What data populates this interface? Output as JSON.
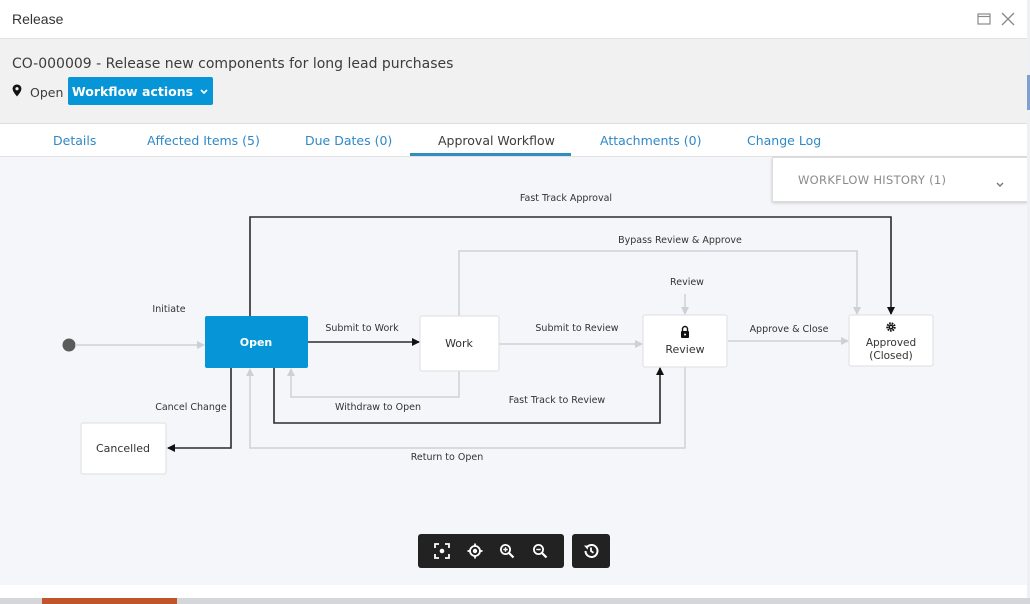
{
  "window": {
    "title": "Release",
    "maximize_icon": "window-maximize-icon",
    "close_icon": "close-icon"
  },
  "header": {
    "item_title": "CO-000009 - Release new components for long lead purchases",
    "state_icon": "map-pin-icon",
    "state": "Open",
    "workflow_actions_label": "Workflow actions"
  },
  "tabs": [
    {
      "label": "Details",
      "active": false
    },
    {
      "label": "Affected Items (5)",
      "active": false
    },
    {
      "label": "Due Dates (0)",
      "active": false
    },
    {
      "label": "Approval Workflow",
      "active": true
    },
    {
      "label": "Attachments (0)",
      "active": false
    },
    {
      "label": "Change Log",
      "active": false
    }
  ],
  "workflow_history": {
    "label": "WORKFLOW HISTORY (1)"
  },
  "diagram": {
    "states": [
      {
        "id": "open",
        "label": "Open",
        "current": true
      },
      {
        "id": "work",
        "label": "Work"
      },
      {
        "id": "review",
        "label": "Review",
        "icon": "lock-icon"
      },
      {
        "id": "approved",
        "label": "Approved",
        "label2": "(Closed)",
        "icon": "gear-icon"
      },
      {
        "id": "cancelled",
        "label": "Cancelled"
      }
    ],
    "transitions": [
      {
        "label": "Initiate",
        "from": "start",
        "to": "open"
      },
      {
        "label": "Submit to Work",
        "from": "open",
        "to": "work"
      },
      {
        "label": "Submit to Review",
        "from": "work",
        "to": "review"
      },
      {
        "label": "Approve & Close",
        "from": "review",
        "to": "approved"
      },
      {
        "label": "Fast Track Approval",
        "from": "open",
        "to": "approved"
      },
      {
        "label": "Bypass Review & Approve",
        "from": "work",
        "to": "approved"
      },
      {
        "label": "Review",
        "from": "review",
        "to": "review"
      },
      {
        "label": "Withdraw to Open",
        "from": "work",
        "to": "open"
      },
      {
        "label": "Fast Track to Review",
        "from": "open",
        "to": "review"
      },
      {
        "label": "Cancel Change",
        "from": "open",
        "to": "cancelled"
      },
      {
        "label": "Return to Open",
        "from": "review",
        "to": "open"
      }
    ]
  },
  "toolbar": {
    "buttons": [
      "fit-to-screen",
      "center",
      "zoom-in",
      "zoom-out"
    ],
    "history_button": "history"
  },
  "colors": {
    "accent": "#0696d7",
    "active_transition": "#2b2b2b",
    "inactive_transition": "#cdd0d6"
  }
}
